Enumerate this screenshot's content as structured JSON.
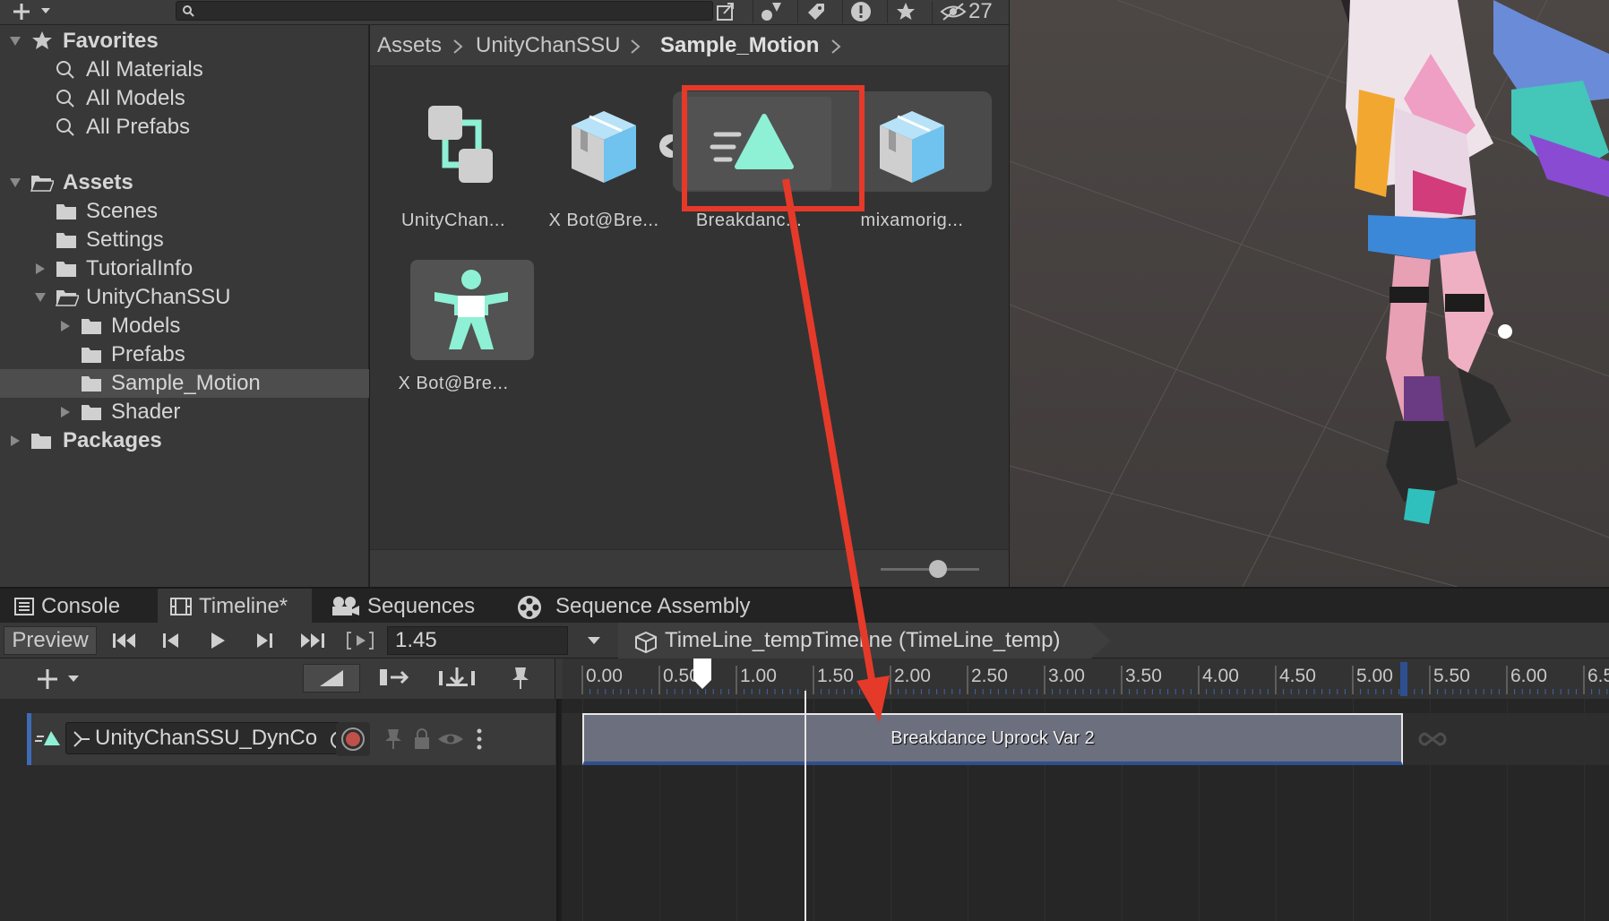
{
  "toolbar": {
    "hidden_count": "27"
  },
  "favorites": {
    "title": "Favorites",
    "items": [
      "All Materials",
      "All Models",
      "All Prefabs"
    ]
  },
  "tree": {
    "assets_label": "Assets",
    "items": [
      "Scenes",
      "Settings",
      "TutorialInfo",
      "UnityChanSSU",
      "Models",
      "Prefabs",
      "Sample_Motion",
      "Shader"
    ],
    "packages_label": "Packages"
  },
  "breadcrumb": {
    "parts": [
      "Assets",
      "UnityChanSSU",
      "Sample_Motion"
    ]
  },
  "assets": [
    {
      "label": "UnityChan..."
    },
    {
      "label": "X Bot@Bre..."
    },
    {
      "label": "Breakdanc..."
    },
    {
      "label": "mixamorig..."
    },
    {
      "label": "X Bot@Bre..."
    }
  ],
  "tabs": [
    "Console",
    "Timeline*",
    "Sequences",
    "Sequence Assembly"
  ],
  "timeline": {
    "preview_label": "Preview",
    "current_time": "1.45",
    "asset_name": "TimeLine_tempTimeline (TimeLine_temp)",
    "ruler_ticks": [
      "0.00",
      "0.50",
      "1.00",
      "1.50",
      "2.00",
      "2.50",
      "3.00",
      "3.50",
      "4.00",
      "4.50",
      "5.00",
      "5.50",
      "6.00",
      "6.5"
    ],
    "track_object": "UnityChanSSU_DynCo",
    "clip_label": "Breakdance Uprock Var 2"
  },
  "colors": {
    "accent_teal": "#8ef0d4",
    "highlight_red": "#e53a2a",
    "selection_blue": "#3e6bb5"
  }
}
